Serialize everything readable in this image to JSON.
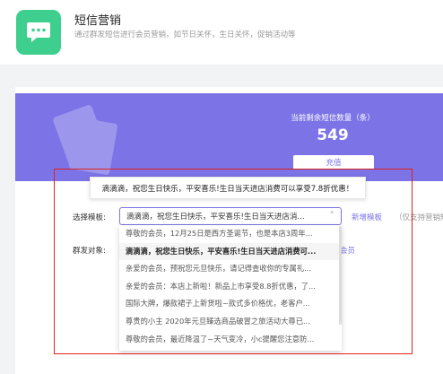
{
  "app": {
    "title": "短信营销",
    "description": "通过群发短信进行会员营销，如节日关怀，生日关怀，促销活动等",
    "icon": "message-bubble-icon",
    "icon_color": "#3ecf8e"
  },
  "banner": {
    "color": "#7b73e6",
    "remaining_label": "当前剩余短信数量（条）",
    "remaining_count": "549",
    "recharge_label": "充值"
  },
  "tooltip_text": "滴滴滴，祝您生日快乐，平安喜乐!生日当天进店消费可以享受7.8折优惠！",
  "form": {
    "template_label": "选择模板:",
    "template_value": "滴滴滴，祝您生日快乐，平安喜乐!生日当天进店消...",
    "new_template_label": "新增模板",
    "new_template_note": "（仅支持营销短",
    "target_label": "群发对象:",
    "member_link": "会员"
  },
  "template_options": [
    "尊敬的会员，12月25日是西方圣诞节，也是本店3周年...",
    "滴滴滴，祝您生日快乐，平安喜乐!生日当天进店消费可...",
    "亲爱的会员，预祝您元旦快乐，请记得查收你的专属礼...",
    "亲爱的会员：本店上新啦！新品上市享受8.8折优惠，了...",
    "国际大牌，爆款裙子上新货啦~款式多价格优，老客户...",
    "尊贵的小主 2020年元旦臻选商品破冒之旅活动大尊已...",
    "尊敬的会员，最近降温了~天气变冷，小c提醒您注意防..."
  ],
  "selected_index": 1,
  "highlight_color": "#e02020"
}
